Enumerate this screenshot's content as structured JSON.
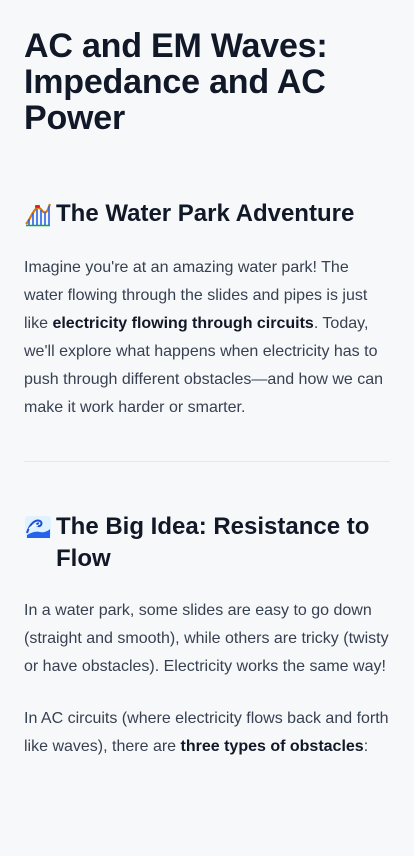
{
  "page": {
    "title": "AC and EM Waves: Impedance and AC Power"
  },
  "section1": {
    "heading": "The Water Park Adventure",
    "icon": "roller-coaster-emoji",
    "paragraph": {
      "before": "Imagine you're at an amazing water park! The water flowing through the slides and pipes is just like ",
      "bold": "electricity flowing through circuits",
      "after": ". Today, we'll explore what happens when electricity has to push through different obstacles—and how we can make it work harder or smarter."
    }
  },
  "section2": {
    "heading": "The Big Idea: Resistance to Flow",
    "icon": "wave-emoji",
    "paragraph1": "In a water park, some slides are easy to go down (straight and smooth), while others are tricky (twisty or have obstacles). Electricity works the same way!",
    "paragraph2": {
      "before": "In AC circuits (where electricity flows back and forth like waves), there are ",
      "bold": "three types of obstacles",
      "after": ":"
    }
  },
  "colors": {
    "background": "#f7f8fa",
    "heading": "#111827",
    "body_text": "#374151",
    "divider": "#e5e7eb"
  }
}
